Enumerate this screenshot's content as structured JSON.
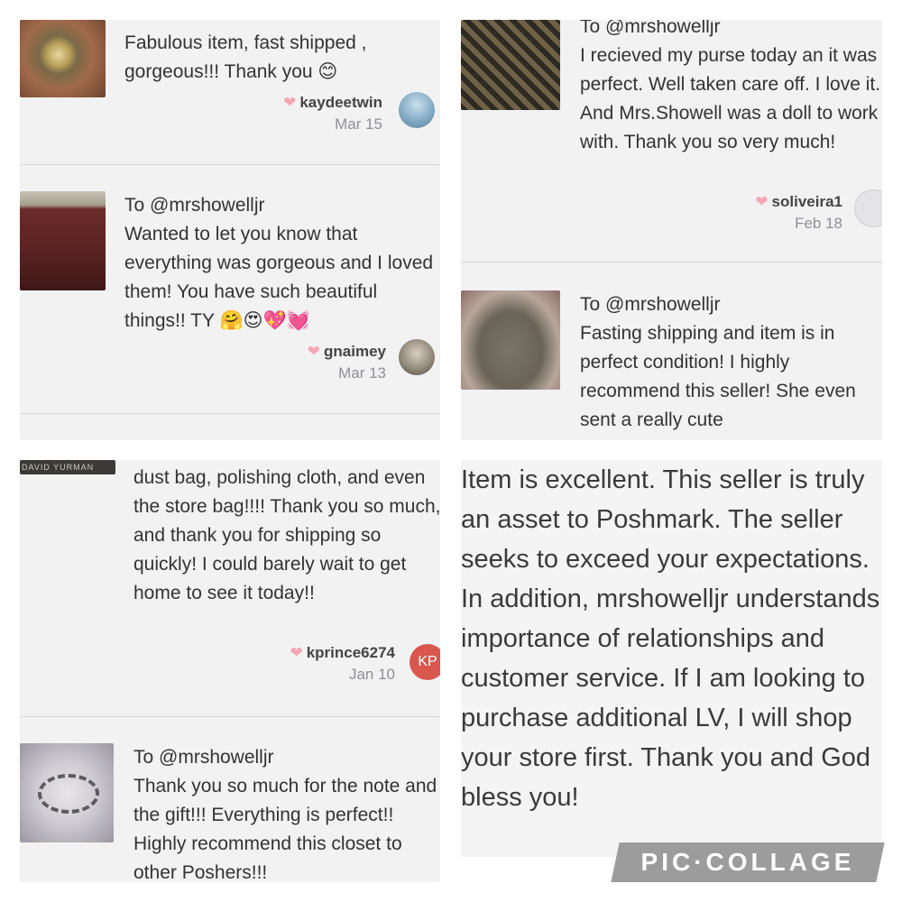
{
  "panel1": {
    "review1": {
      "text": "Fabulous item, fast shipped , gorgeous!!! Thank you 😊",
      "user": "kaydeetwin",
      "date": "Mar 15"
    },
    "review2": {
      "to": "To @mrshowelljr",
      "text": "Wanted to let you know that everything was gorgeous and I loved them! You have such beautiful things!! TY 🤗😍💖💓",
      "user": "gnaimey",
      "date": "Mar 13"
    }
  },
  "panel2": {
    "review1": {
      "to": "To @mrshowelljr",
      "text": "I recieved my purse today an it was perfect. Well taken care off. I love it. And Mrs.Showell was a doll to work with. Thank you so very much!",
      "user": "soliveira1",
      "date": "Feb 18"
    },
    "review2": {
      "to": "To @mrshowelljr",
      "text": "Fasting shipping and item is in perfect condition! I highly recommend this seller! She even sent a really cute"
    }
  },
  "panel3": {
    "thumb_label": "DAVID YURMAN",
    "review1": {
      "text": "dust bag, polishing cloth, and even the store bag!!!! Thank you so much, and thank you for shipping so quickly! I could barely wait to get home to see it today!!",
      "user": "kprince6274",
      "date": "Jan 10",
      "avatar_initials": "KP"
    },
    "review2": {
      "to": "To @mrshowelljr",
      "text": "Thank you so much for the note and the gift!!! Everything is perfect!! Highly recommend this closet to other Poshers!!!"
    }
  },
  "panel4": {
    "text": "Item is excellent. This seller is truly an asset to Poshmark. The seller seeks to exceed your expectations. In addition, mrshowelljr understands importance of relationships and customer service. If I am looking to purchase additional LV, I will shop your store first. Thank you and God bless you!"
  },
  "watermark": "PIC·COLLAGE",
  "colors": {
    "heart": "#f4a7b5",
    "panel_bg": "#f2f2f3",
    "badge_bg": "#9c9c9c",
    "kp_avatar": "#d9574f"
  }
}
